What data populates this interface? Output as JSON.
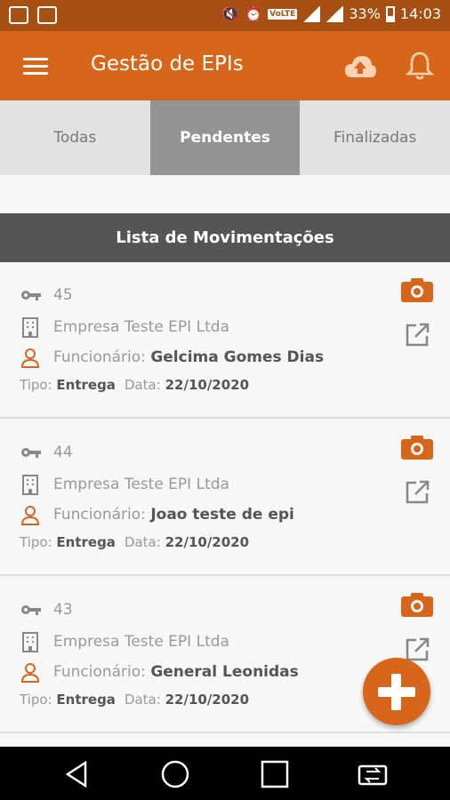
{
  "status_bar": {
    "battery": "33%",
    "time": "14:03",
    "network": "VoLTE"
  },
  "app_bar": {
    "title": "Gestão de EPIs"
  },
  "tabs": [
    {
      "label": "Todas"
    },
    {
      "label": "Pendentes",
      "active": true
    },
    {
      "label": "Finalizadas"
    }
  ],
  "list": {
    "header": "Lista de Movimentações",
    "items": [
      {
        "id": "45",
        "empresa": "Empresa Teste  EPI Ltda",
        "funcionario_label": "Funcionário:",
        "funcionario": "Gelcima Gomes Dias",
        "tipo_label": "Tipo:",
        "tipo": "Entrega",
        "data_label": "Data:",
        "data": "22/10/2020"
      },
      {
        "id": "44",
        "empresa": "Empresa Teste  EPI Ltda",
        "funcionario_label": "Funcionário:",
        "funcionario": "Joao teste de epi",
        "tipo_label": "Tipo:",
        "tipo": "Entrega",
        "data_label": "Data:",
        "data": "22/10/2020"
      },
      {
        "id": "43",
        "empresa": "Empresa Teste  EPI Ltda",
        "funcionario_label": "Funcionário:",
        "funcionario": "General Leonidas",
        "tipo_label": "Tipo:",
        "tipo": "Entrega",
        "data_label": "Data:",
        "data": "22/10/2020"
      }
    ]
  },
  "colors": {
    "primary": "#d8661a",
    "statusbar": "#a84f13",
    "tab_active": "#949494",
    "header": "#555555"
  },
  "icons": [
    "menu-icon",
    "upload-cloud-icon",
    "bell-icon",
    "key-icon",
    "building-icon",
    "person-icon",
    "camera-icon",
    "open-external-icon",
    "add-icon"
  ]
}
